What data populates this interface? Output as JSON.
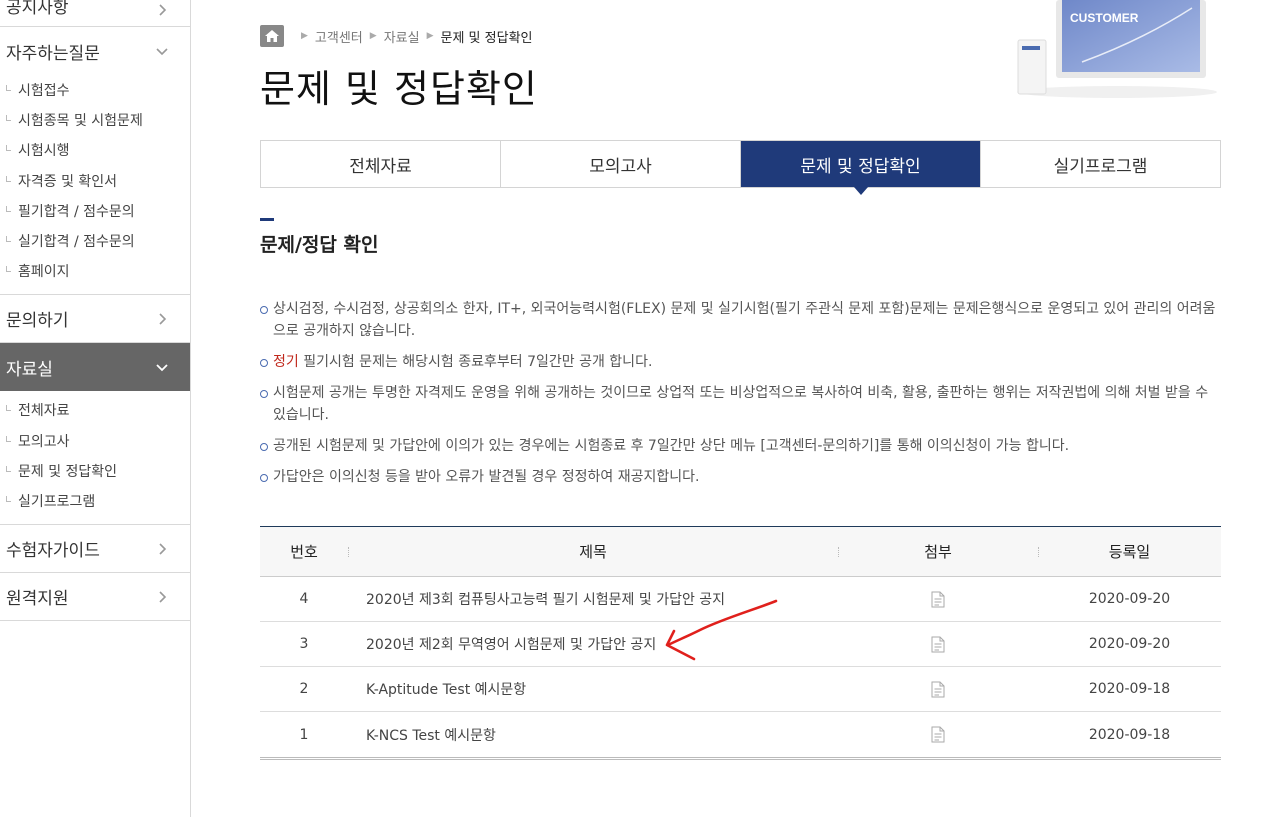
{
  "sidebar": {
    "groups": [
      {
        "label": "공지사항"
      },
      {
        "label": "자주하는질문",
        "items": [
          "시험접수",
          "시험종목 및 시험문제",
          "시험시행",
          "자격증 및 확인서",
          "필기합격 / 점수문의",
          "실기합격 / 점수문의",
          "홈페이지"
        ]
      },
      {
        "label": "문의하기"
      },
      {
        "label": "자료실",
        "items": [
          "전체자료",
          "모의고사",
          "문제 및 정답확인",
          "실기프로그램"
        ]
      },
      {
        "label": "수험자가이드"
      },
      {
        "label": "원격지원"
      }
    ]
  },
  "breadcrumb": {
    "items": [
      "고객센터",
      "자료실",
      "문제 및 정답확인"
    ]
  },
  "page_title": "문제 및 정답확인",
  "banner": {
    "text": "CUSTOMER"
  },
  "tabs": [
    {
      "label": "전체자료"
    },
    {
      "label": "모의고사"
    },
    {
      "label": "문제 및 정답확인",
      "active": true
    },
    {
      "label": "실기프로그램"
    }
  ],
  "section_title": "문제/정답 확인",
  "notes": [
    {
      "text": "상시검정, 수시검정, 상공회의소 한자, IT+, 외국어능력시험(FLEX) 문제 및 실기시험(필기 주관식 문제 포함)문제는 문제은행식으로 운영되고 있어 관리의 어려움으로 공개하지 않습니다."
    },
    {
      "highlight": "정기",
      "text": " 필기시험 문제는 해당시험 종료후부터 7일간만 공개 합니다."
    },
    {
      "text": "시험문제 공개는 투명한 자격제도 운영을 위해 공개하는 것이므로 상업적 또는 비상업적으로 복사하여 비축, 활용, 출판하는 행위는 저작권법에 의해 처벌 받을 수 있습니다."
    },
    {
      "text": "공개된 시험문제 및 가답안에 이의가 있는 경우에는 시험종료 후 7일간만 상단 메뉴 [고객센터-문의하기]를 통해 이의신청이 가능 합니다."
    },
    {
      "text": "가답안은 이의신청 등을 받아 오류가 발견될 경우 정정하여 재공지합니다."
    }
  ],
  "table": {
    "headers": {
      "no": "번호",
      "title": "제목",
      "attach": "첨부",
      "date": "등록일"
    },
    "rows": [
      {
        "no": "4",
        "title": "2020년 제3회 컴퓨팅사고능력 필기 시험문제 및 가답안 공지",
        "date": "2020-09-20"
      },
      {
        "no": "3",
        "title": "2020년 제2회 무역영어 시험문제 및 가답안 공지",
        "date": "2020-09-20"
      },
      {
        "no": "2",
        "title": "K-Aptitude Test 예시문항",
        "date": "2020-09-18"
      },
      {
        "no": "1",
        "title": "K-NCS Test 예시문항",
        "date": "2020-09-18"
      }
    ]
  },
  "colors": {
    "accent": "#1f3a7a",
    "sidebar_active": "#666666",
    "highlight_red": "#c0281c",
    "annotation": "#e0201c"
  },
  "icons": {
    "home": "home-icon",
    "chevron_right": "chevron-right-icon",
    "chevron_down": "chevron-down-icon",
    "attachment": "file-icon"
  }
}
